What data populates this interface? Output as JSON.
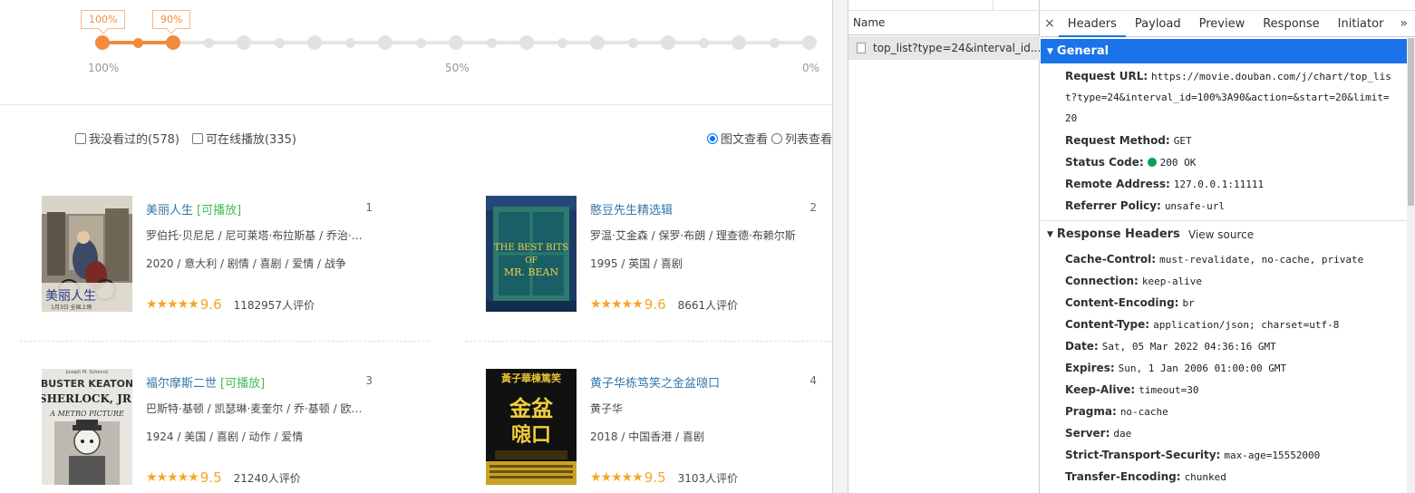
{
  "slider": {
    "badge_left": "100%",
    "badge_right": "90%",
    "label_start": "100%",
    "label_mid": "50%",
    "label_end": "0%",
    "selected_range": [
      1.0,
      0.9
    ]
  },
  "filters": {
    "unwatched": "我没看过的(578)",
    "playable": "可在线播放(335)"
  },
  "view_modes": {
    "image_text": "图文查看",
    "list": "列表查看"
  },
  "movies": [
    {
      "title": "美丽人生",
      "playable": "[可播放]",
      "rank": "1",
      "actors": "罗伯托·贝尼尼 / 尼可莱塔·布拉斯基 / 乔治·坎塔里尼",
      "meta": "2020 / 意大利 / 剧情 / 喜剧 / 爱情 / 战争",
      "stars": "★★★★★",
      "score": "9.6",
      "votes": "1182957人评价",
      "poster_text": "美丽人生",
      "poster_caption": "1月3日 全国上映"
    },
    {
      "title": "憨豆先生精选辑",
      "playable": "",
      "rank": "2",
      "actors": "罗温·艾金森 / 保罗·布朗 / 理查德·布赖尔斯",
      "meta": "1995 / 英国 / 喜剧",
      "stars": "★★★★★",
      "score": "9.6",
      "votes": "8661人评价",
      "poster_text_1": "THE BEST BITS",
      "poster_text_2": "OF",
      "poster_text_3": "MR. BEAN"
    },
    {
      "title": "福尔摩斯二世",
      "playable": "[可播放]",
      "rank": "3",
      "actors": "巴斯特·基顿 / 凯瑟琳·麦奎尔 / 乔·基顿 / 欧文·梅耶",
      "meta": "1924 / 美国 / 喜剧 / 动作 / 爱情",
      "stars": "★★★★★",
      "score": "9.5",
      "votes": "21240人评价",
      "poster_text_0": "Joseph M. Schenck",
      "poster_text_1": "BUSTER KEATON",
      "poster_text_2": "SHERLOCK, JR.",
      "poster_text_3": "A METRO PICTURE"
    },
    {
      "title": "黄子华栋笃笑之金盆𠺘口",
      "playable": "",
      "rank": "4",
      "actors": "黄子华",
      "meta": "2018 / 中国香港 / 喜剧",
      "stars": "★★★★★",
      "score": "9.5",
      "votes": "3103人评价",
      "poster_text_1": "黃子華棟篤笑",
      "poster_text_2": "金盆",
      "poster_text_3": "𠺘口"
    }
  ],
  "devtools": {
    "name_header": "Name",
    "request_name": "top_list?type=24&interval_id...",
    "close_symbol": "×",
    "tabs": [
      "Headers",
      "Payload",
      "Preview",
      "Response",
      "Initiator"
    ],
    "more_tabs": "»",
    "general": {
      "title": "General",
      "request_url_key": "Request URL:",
      "request_url": "https://movie.douban.com/j/chart/top_list?type=24&interval_id=100%3A90&action=&start=20&limit=20",
      "request_method_key": "Request Method:",
      "request_method": "GET",
      "status_code_key": "Status Code:",
      "status_code": "200 OK",
      "remote_address_key": "Remote Address:",
      "remote_address": "127.0.0.1:11111",
      "referrer_policy_key": "Referrer Policy:",
      "referrer_policy": "unsafe-url"
    },
    "response_headers": {
      "title": "Response Headers",
      "view_source": "View source",
      "items": [
        {
          "k": "Cache-Control:",
          "v": "must-revalidate, no-cache, private"
        },
        {
          "k": "Connection:",
          "v": "keep-alive"
        },
        {
          "k": "Content-Encoding:",
          "v": "br"
        },
        {
          "k": "Content-Type:",
          "v": "application/json; charset=utf-8"
        },
        {
          "k": "Date:",
          "v": "Sat, 05 Mar 2022 04:36:16 GMT"
        },
        {
          "k": "Expires:",
          "v": "Sun, 1 Jan 2006 01:00:00 GMT"
        },
        {
          "k": "Keep-Alive:",
          "v": "timeout=30"
        },
        {
          "k": "Pragma:",
          "v": "no-cache"
        },
        {
          "k": "Server:",
          "v": "dae"
        },
        {
          "k": "Strict-Transport-Security:",
          "v": "max-age=15552000"
        },
        {
          "k": "Transfer-Encoding:",
          "v": "chunked"
        }
      ]
    }
  },
  "colors": {
    "accent_orange": "#f28b3c",
    "link_blue": "#3377aa",
    "playable_green": "#42bd56",
    "star_orange": "#f6a623",
    "devtools_blue": "#1a73e8",
    "status_green": "#0f9d58"
  }
}
